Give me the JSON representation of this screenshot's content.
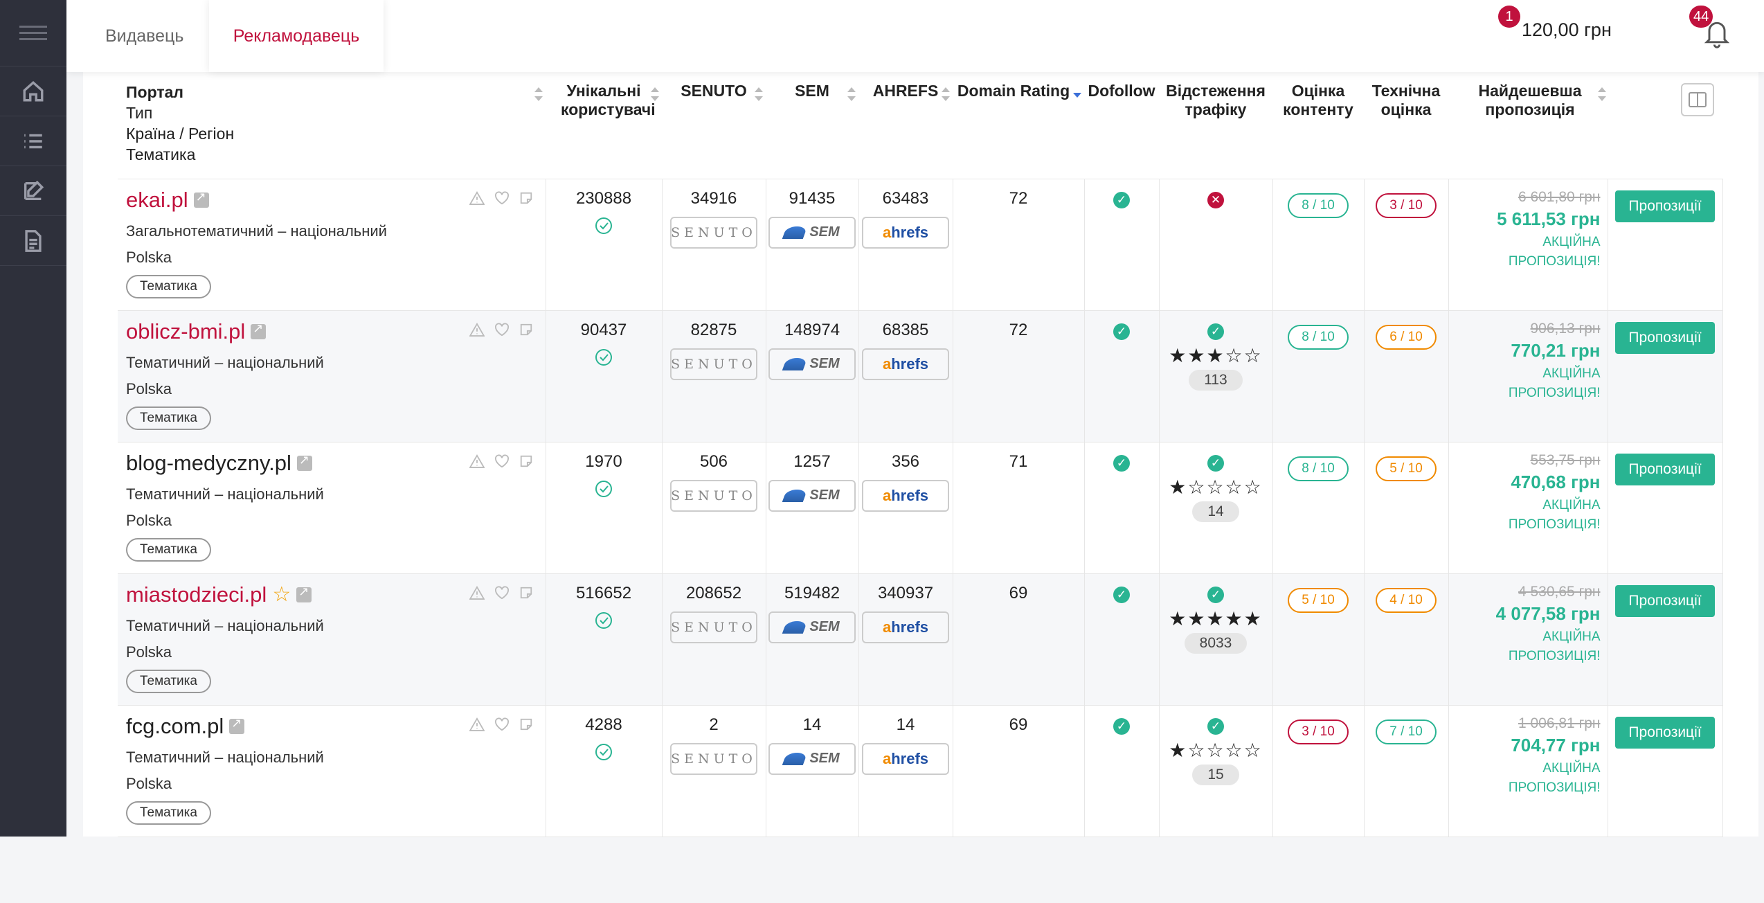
{
  "tabs": {
    "publisher": "Видавець",
    "advertiser": "Рекламодавець"
  },
  "header": {
    "balance": "120,00 грн",
    "balance_badge": "1",
    "notifications_badge": "44"
  },
  "table": {
    "headers": {
      "portal": "Портал",
      "type": "Тип",
      "country": "Країна / Регіон",
      "topic": "Тематика",
      "unique_users": "Унікальні користувачі",
      "senuto": "SENUTO",
      "sem": "SEM",
      "ahrefs": "AHREFS",
      "domain_rating": "Domain Rating",
      "dofollow": "Dofollow",
      "traffic_tracking": "Відстеження трафіку",
      "content_score": "Оцінка контенту",
      "tech_score": "Технічна оцінка",
      "cheapest_offer": "Найдешевша пропозиція"
    },
    "rows": [
      {
        "site": "ekai.pl",
        "type": "Загальнотематичний – національний",
        "country": "Polska",
        "topic": "Тематика",
        "users": "230888",
        "senuto": "34916",
        "sem": "91435",
        "ahrefs": "63483",
        "dr": "72",
        "tracking": "no",
        "stars": "",
        "reviews": "",
        "content": "8 / 10",
        "tech": "3 / 10",
        "old_price": "6 601,80 грн",
        "new_price": "5 611,53 грн",
        "promo": "АКЦІЙНА ПРОПОЗИЦІЯ!",
        "button": "Пропозиції"
      },
      {
        "site": "oblicz-bmi.pl",
        "type": "Тематичний – національний",
        "country": "Polska",
        "topic": "Тематика",
        "users": "90437",
        "senuto": "82875",
        "sem": "148974",
        "ahrefs": "68385",
        "dr": "72",
        "tracking": "yes",
        "stars": "★★★☆☆",
        "reviews": "113",
        "content": "8 / 10",
        "tech": "6 / 10",
        "old_price": "906,13 грн",
        "new_price": "770,21 грн",
        "promo": "АКЦІЙНА ПРОПОЗИЦІЯ!",
        "button": "Пропозиції"
      },
      {
        "site": "blog-medyczny.pl",
        "type": "Тематичний – національний",
        "country": "Polska",
        "topic": "Тематика",
        "users": "1970",
        "senuto": "506",
        "sem": "1257",
        "ahrefs": "356",
        "dr": "71",
        "tracking": "yes",
        "stars": "★☆☆☆☆",
        "reviews": "14",
        "content": "8 / 10",
        "tech": "5 / 10",
        "old_price": "553,75 грн",
        "new_price": "470,68 грн",
        "promo": "АКЦІЙНА ПРОПОЗИЦІЯ!",
        "button": "Пропозиції"
      },
      {
        "site": "miastodzieci.pl",
        "type": "Тематичний – національний",
        "country": "Polska",
        "topic": "Тематика",
        "users": "516652",
        "senuto": "208652",
        "sem": "519482",
        "ahrefs": "340937",
        "dr": "69",
        "tracking": "yes",
        "stars": "★★★★★",
        "reviews": "8033",
        "content": "5 / 10",
        "tech": "4 / 10",
        "old_price": "4 530,65 грн",
        "new_price": "4 077,58 грн",
        "promo": "АКЦІЙНА ПРОПОЗИЦІЯ!",
        "button": "Пропозиції"
      },
      {
        "site": "fcg.com.pl",
        "type": "Тематичний – національний",
        "country": "Polska",
        "topic": "Тематика",
        "users": "4288",
        "senuto": "2",
        "sem": "14",
        "ahrefs": "14",
        "dr": "69",
        "tracking": "yes",
        "stars": "★☆☆☆☆",
        "reviews": "15",
        "content": "3 / 10",
        "tech": "7 / 10",
        "old_price": "1 006,81 грн",
        "new_price": "704,77 грн",
        "promo": "АКЦІЙНА ПРОПОЗИЦІЯ!",
        "button": "Пропозиції"
      }
    ]
  },
  "logos": {
    "senuto": "SENUTO",
    "sem": "SEM",
    "ahrefs_a": "a",
    "ahrefs_rest": "hrefs"
  },
  "colors": {
    "accent": "#c0123d",
    "green": "#29b492",
    "orange": "#f08a00",
    "sidebar": "#2e303b"
  }
}
